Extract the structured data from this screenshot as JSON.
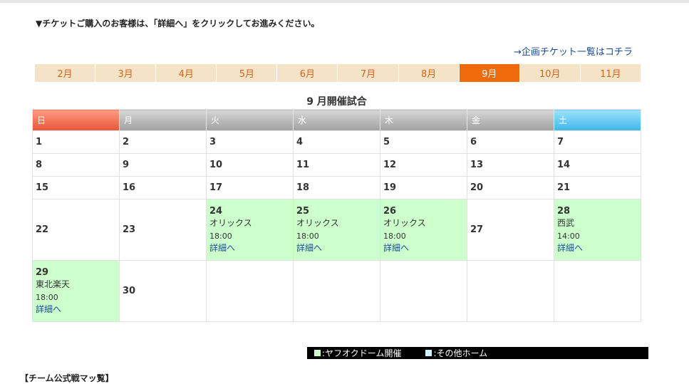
{
  "notice": "▼チケットご購入のお客様は、「詳細へ」をクリックしてお進みください。",
  "plan_link": "→企画チケット一覧はコチラ",
  "months": [
    {
      "label": "2月",
      "active": false
    },
    {
      "label": "3月",
      "active": false
    },
    {
      "label": "4月",
      "active": false
    },
    {
      "label": "5月",
      "active": false
    },
    {
      "label": "6月",
      "active": false
    },
    {
      "label": "7月",
      "active": false
    },
    {
      "label": "8月",
      "active": false
    },
    {
      "label": "9月",
      "active": true
    },
    {
      "label": "10月",
      "active": false
    },
    {
      "label": "11月",
      "active": false
    }
  ],
  "calendar": {
    "title": "9 月開催試合",
    "weekdays": [
      "日",
      "月",
      "火",
      "水",
      "木",
      "金",
      "土"
    ],
    "days": {
      "d1": "1",
      "d2": "2",
      "d3": "3",
      "d4": "4",
      "d5": "5",
      "d6": "6",
      "d7": "7",
      "d8": "8",
      "d9": "9",
      "d10": "10",
      "d11": "11",
      "d12": "12",
      "d13": "13",
      "d14": "14",
      "d15": "15",
      "d16": "16",
      "d17": "17",
      "d18": "18",
      "d19": "19",
      "d20": "20",
      "d21": "21",
      "d22": "22",
      "d23": "23",
      "d27": "27",
      "d30": "30"
    },
    "games": {
      "g24": {
        "day": "24",
        "opponent": "オリックス",
        "time": "18:00",
        "link": "詳細へ"
      },
      "g25": {
        "day": "25",
        "opponent": "オリックス",
        "time": "18:00",
        "link": "詳細へ"
      },
      "g26": {
        "day": "26",
        "opponent": "オリックス",
        "time": "18:00",
        "link": "詳細へ"
      },
      "g28": {
        "day": "28",
        "opponent": "西武",
        "time": "14:00",
        "link": "詳細へ"
      },
      "g29": {
        "day": "29",
        "opponent": "東北楽天",
        "time": "18:00",
        "link": "詳細へ"
      }
    }
  },
  "legend": {
    "home_dome": ":ヤフオクドーム開催",
    "other_home": ":その他ホーム",
    "home_dome_color": "#ccffcc",
    "other_home_color": "#ccf5ff"
  },
  "bottom_heading": "【チーム公式戦マッ覧】",
  "colors": {
    "accent": "#ee6a0b",
    "link": "#1a4d8f",
    "game_bg": "#ccffcc"
  }
}
